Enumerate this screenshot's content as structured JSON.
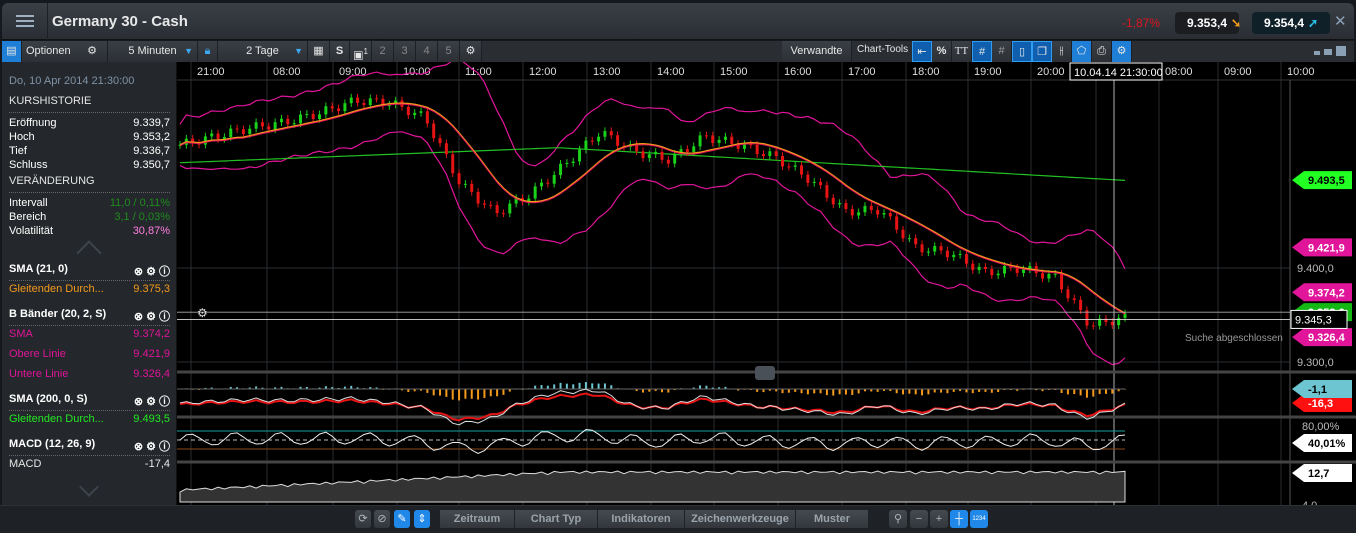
{
  "header": {
    "title": "Germany 30 - Cash",
    "change": "-1,87%",
    "sell": "9.353,4",
    "buy": "9.354,4",
    "change_color": "#e0141e"
  },
  "toolbar": {
    "options": "Optionen",
    "interval": "5 Minuten",
    "range": "2 Tage",
    "s_label": "S",
    "slot_badge": "1",
    "slots": [
      "2",
      "3",
      "4",
      "5"
    ],
    "related": "Verwandte",
    "chart_tools": "Chart-Tools",
    "percent": "%",
    "text_tool": "TT"
  },
  "panel": {
    "datetime": "Do, 10 Apr 2014     21:30:00",
    "history_title": "KURSHISTORIE",
    "history": [
      {
        "label": "Eröffnung",
        "value": "9.339,7"
      },
      {
        "label": "Hoch",
        "value": "9.353,2"
      },
      {
        "label": "Tief",
        "value": "9.336,7"
      },
      {
        "label": "Schluss",
        "value": "9.350,7"
      }
    ],
    "change_title": "VERÄNDERUNG",
    "changes": [
      {
        "label": "Intervall",
        "value": "11,0 / 0,11%",
        "color": "#1e8c1e"
      },
      {
        "label": "Bereich",
        "value": "3,1 / 0,03%",
        "color": "#1e8c1e"
      },
      {
        "label": "Volatilität",
        "value": "30,87%",
        "color": "#ff7ee0"
      }
    ],
    "indicators": [
      {
        "name": "SMA (21, 0)",
        "lines": [
          {
            "label": "Gleitenden Durch...",
            "value": "9.375,3",
            "color": "#f39a1c"
          }
        ]
      },
      {
        "name": "B Bänder (20, 2, S)",
        "lines": [
          {
            "label": "SMA",
            "value": "9.374,2",
            "color": "#e0159a"
          },
          {
            "label": "Obere Linie",
            "value": "9.421,9",
            "color": "#e0159a"
          },
          {
            "label": "Untere Linie",
            "value": "9.326,4",
            "color": "#e0159a"
          }
        ]
      },
      {
        "name": "SMA (200, 0, S)",
        "lines": [
          {
            "label": "Gleitenden Durch...",
            "value": "9.493,5",
            "color": "#22e822"
          }
        ]
      },
      {
        "name": "MACD (12, 26, 9)",
        "lines": [
          {
            "label": "MACD",
            "value": "-17,4",
            "color": "#e6e6e6"
          }
        ]
      }
    ]
  },
  "chart": {
    "time_labels": [
      "21:00",
      "08:00",
      "09:00",
      "10:00",
      "11:00",
      "12:00",
      "13:00",
      "14:00",
      "15:00",
      "16:00",
      "17:00",
      "18:00",
      "19:00",
      "20:00",
      "21:00",
      "08:00",
      "09:00",
      "10:00"
    ],
    "crosshair_time": "10.04.14 21:30:00",
    "price_ticks": [
      "9.400,0",
      "9.300,0"
    ],
    "closes": [
      9531,
      9540,
      9549,
      9555,
      9565,
      9578,
      9576,
      9560,
      9490,
      9458,
      9478,
      9510,
      9545,
      9524,
      9515,
      9540,
      9531,
      9518,
      9494,
      9460,
      9462,
      9422,
      9416,
      9395,
      9400,
      9390,
      9339,
      9347
    ],
    "labels": {
      "sma200": "9.493,5",
      "upper": "9.421,9",
      "sma": "9.374,2",
      "last": "9.353,0",
      "cross": "9.345,3",
      "lower": "9.326,4",
      "macd_signal": "-1,1",
      "macd": "-16,3",
      "osc_tick": "80,00%",
      "osc": "40,01%",
      "vol": "12,7",
      "vol_tick": "4,0"
    },
    "status": "Suche abgeschlossen",
    "colors": {
      "up": "#19d219",
      "down": "#e61414",
      "sma": "#f39a1c",
      "bands": "#e0159a",
      "sma200": "#22c022"
    }
  },
  "bottom": {
    "tabs": [
      "Zeitraum",
      "Chart Typ",
      "Indikatoren",
      "Zeichenwerkzeuge",
      "Muster"
    ],
    "grid_badge": "1234"
  }
}
